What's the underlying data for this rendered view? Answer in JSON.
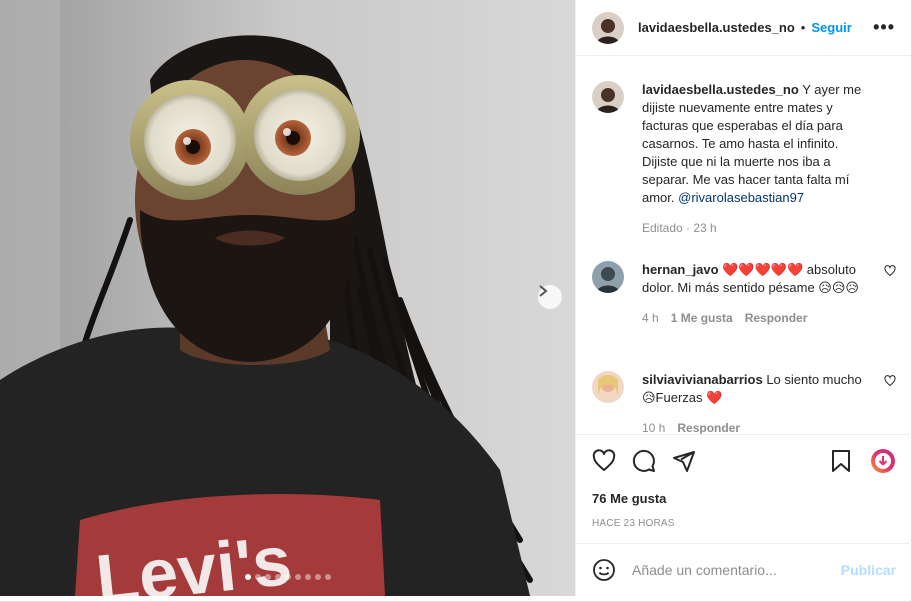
{
  "post": {
    "username": "lavidaesbella.ustedes_no",
    "separator": "•",
    "follow_label": "Seguir",
    "more_label": "•••",
    "caption_text": "Y ayer me dijiste nuevamente entre mates y facturas que esperabas el día para casarnos. Te amo hasta el infinito. Dijiste que ni la muerte nos iba a separar. Me vas hacer tanta falta mí amor.",
    "caption_mention": "@rivarolasebastian97",
    "caption_meta": "Editado · 23 h"
  },
  "media": {
    "shirt_text": "Levi's",
    "slide_count": 9,
    "active_slide": 1
  },
  "comments": [
    {
      "username": "hernan_javo",
      "text": "absoluto dolor. Mi más sentido pésame 😥😥😥",
      "emoji_prefix": "❤️❤️❤️❤️❤️",
      "time": "4 h",
      "likes": "1 Me gusta",
      "reply": "Responder"
    },
    {
      "username": "silviavivianabarrios",
      "text": "Lo siento mucho 😥Fuerzas",
      "emoji_suffix": "❤️",
      "time": "10 h",
      "reply": "Responder"
    }
  ],
  "footer": {
    "likes_label": "76 Me gusta",
    "timestamp": "HACE 23 HORAS",
    "comment_placeholder": "Añade un comentario...",
    "publish_label": "Publicar"
  },
  "colors": {
    "accent": "#0095f6",
    "publish_disabled": "#b2dffc",
    "heart": "#e0245e"
  }
}
